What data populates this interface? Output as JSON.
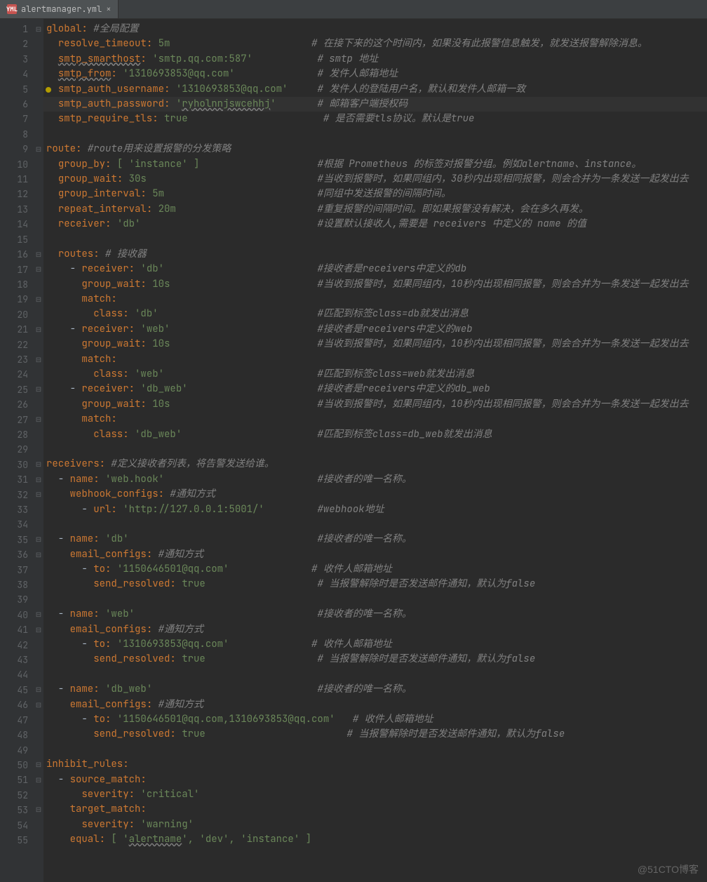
{
  "tab": {
    "filename": "alertmanager.yml",
    "icon": "YML"
  },
  "gutter": [
    "1",
    "2",
    "3",
    "4",
    "5",
    "6",
    "7",
    "8",
    "9",
    "10",
    "11",
    "12",
    "13",
    "14",
    "15",
    "16",
    "17",
    "18",
    "19",
    "20",
    "21",
    "22",
    "23",
    "24",
    "25",
    "26",
    "27",
    "28",
    "29",
    "30",
    "31",
    "32",
    "33",
    "34",
    "35",
    "36",
    "37",
    "38",
    "39",
    "40",
    "41",
    "42",
    "43",
    "44",
    "45",
    "46",
    "47",
    "48",
    "49",
    "50",
    "51",
    "52",
    "53",
    "54",
    "55"
  ],
  "code": {
    "l1": {
      "k": "global",
      "colon": ": ",
      "c": "#全局配置"
    },
    "l2": {
      "pad": "  ",
      "k": "resolve_timeout",
      "colon": ": ",
      "v": "5m",
      "cpad": "                        ",
      "c": "# 在接下来的这个时间内，如果没有此报警信息触发，就发送报警解除消息。"
    },
    "l3": {
      "pad": "  ",
      "k": "smtp_smarthost",
      "colon": ": ",
      "v": "'smtp.qq.com:587'",
      "cpad": "           ",
      "c": "# smtp 地址"
    },
    "l4": {
      "pad": "  ",
      "k": "smtp_from",
      "colon": ": ",
      "v": "'1310693853@qq.com'",
      "cpad": "              ",
      "c": "# 发件人邮箱地址"
    },
    "l5": {
      "pad": "  ",
      "k": "smtp_auth_username",
      "colon": ": ",
      "v": "'1310693853@qq.com'",
      "cpad": "     ",
      "c": "# 发件人的登陆用户名，默认和发件人邮箱一致"
    },
    "l6": {
      "pad": "  ",
      "k": "smtp_auth_password",
      "colon": ": ",
      "v": "'ryholnnjswcehhj'",
      "cpad": "       ",
      "c": "# 邮箱客户端授权码"
    },
    "l7": {
      "pad": "  ",
      "k": "smtp_require_tls",
      "colon": ": ",
      "v": "true",
      "cpad": "                       ",
      "c": "# 是否需要tls协议。默认是true"
    },
    "l9": {
      "k": "route",
      "colon": ": ",
      "c": "#route用来设置报警的分发策略"
    },
    "l10": {
      "pad": "  ",
      "k": "group_by",
      "colon": ": ",
      "v": "[ 'instance' ]",
      "cpad": "                    ",
      "c": "#根据 Prometheus 的标签对报警分组。例如alertname、instance。"
    },
    "l11": {
      "pad": "  ",
      "k": "group_wait",
      "colon": ": ",
      "v": "30s",
      "cpad": "                             ",
      "c": "#当收到报警时，如果同组内，30秒内出现相同报警，则会合并为一条发送一起发出去"
    },
    "l12": {
      "pad": "  ",
      "k": "group_interval",
      "colon": ": ",
      "v": "5m",
      "cpad": "                          ",
      "c": "#同组中发送报警的间隔时间。"
    },
    "l13": {
      "pad": "  ",
      "k": "repeat_interval",
      "colon": ": ",
      "v": "20m",
      "cpad": "                        ",
      "c": "#重复报警的间隔时间。即如果报警没有解决，会在多久再发。"
    },
    "l14": {
      "pad": "  ",
      "k": "receiver",
      "colon": ": ",
      "v": "'db'",
      "cpad": "                              ",
      "c": "#设置默认接收人,需要是 receivers 中定义的 name 的值"
    },
    "l16": {
      "pad": "  ",
      "k": "routes",
      "colon": ": ",
      "c": "# 接收器"
    },
    "l17": {
      "pad": "    - ",
      "k": "receiver",
      "colon": ": ",
      "v": "'db'",
      "cpad": "                          ",
      "c": "#接收者是receivers中定义的db"
    },
    "l18": {
      "pad": "      ",
      "k": "group_wait",
      "colon": ": ",
      "v": "10s",
      "cpad": "                         ",
      "c": "#当收到报警时，如果同组内，10秒内出现相同报警，则会合并为一条发送一起发出去"
    },
    "l19": {
      "pad": "      ",
      "k": "match",
      "colon": ":"
    },
    "l20": {
      "pad": "        ",
      "k": "class",
      "colon": ": ",
      "v": "'db'",
      "cpad": "                           ",
      "c": "#匹配到标签class=db就发出消息"
    },
    "l21": {
      "pad": "    - ",
      "k": "receiver",
      "colon": ": ",
      "v": "'web'",
      "cpad": "                         ",
      "c": "#接收者是receivers中定义的web"
    },
    "l22": {
      "pad": "      ",
      "k": "group_wait",
      "colon": ": ",
      "v": "10s",
      "cpad": "                         ",
      "c": "#当收到报警时，如果同组内，10秒内出现相同报警，则会合并为一条发送一起发出去"
    },
    "l23": {
      "pad": "      ",
      "k": "match",
      "colon": ":"
    },
    "l24": {
      "pad": "        ",
      "k": "class",
      "colon": ": ",
      "v": "'web'",
      "cpad": "                          ",
      "c": "#匹配到标签class=web就发出消息"
    },
    "l25": {
      "pad": "    - ",
      "k": "receiver",
      "colon": ": ",
      "v": "'db_web'",
      "cpad": "                      ",
      "c": "#接收者是receivers中定义的db_web"
    },
    "l26": {
      "pad": "      ",
      "k": "group_wait",
      "colon": ": ",
      "v": "10s",
      "cpad": "                         ",
      "c": "#当收到报警时，如果同组内，10秒内出现相同报警，则会合并为一条发送一起发出去"
    },
    "l27": {
      "pad": "      ",
      "k": "match",
      "colon": ":"
    },
    "l28": {
      "pad": "        ",
      "k": "class",
      "colon": ": ",
      "v": "'db_web'",
      "cpad": "                       ",
      "c": "#匹配到标签class=db_web就发出消息"
    },
    "l30": {
      "k": "receivers",
      "colon": ": ",
      "c": "#定义接收者列表，将告警发送给谁。"
    },
    "l31": {
      "pad": "  - ",
      "k": "name",
      "colon": ": ",
      "v": "'web.hook'",
      "cpad": "                          ",
      "c": "#接收者的唯一名称。"
    },
    "l32": {
      "pad": "    ",
      "k": "webhook_configs",
      "colon": ": ",
      "c": "#通知方式"
    },
    "l33": {
      "pad": "      - ",
      "k": "url",
      "colon": ": ",
      "v": "'http://127.0.0.1:5001/'",
      "cpad": "         ",
      "c": "#webhook地址"
    },
    "l35": {
      "pad": "  - ",
      "k": "name",
      "colon": ": ",
      "v": "'db'",
      "cpad": "                                ",
      "c": "#接收者的唯一名称。"
    },
    "l36": {
      "pad": "    ",
      "k": "email_configs",
      "colon": ": ",
      "c": "#通知方式"
    },
    "l37": {
      "pad": "      - ",
      "k": "to",
      "colon": ": ",
      "v": "'1150646501@qq.com'",
      "cpad": "              ",
      "c": "# 收件人邮箱地址"
    },
    "l38": {
      "pad": "        ",
      "k": "send_resolved",
      "colon": ": ",
      "v": "true",
      "cpad": "                   ",
      "c": "# 当报警解除时是否发送邮件通知，默认为false"
    },
    "l40": {
      "pad": "  - ",
      "k": "name",
      "colon": ": ",
      "v": "'web'",
      "cpad": "                               ",
      "c": "#接收者的唯一名称。"
    },
    "l41": {
      "pad": "    ",
      "k": "email_configs",
      "colon": ": ",
      "c": "#通知方式"
    },
    "l42": {
      "pad": "      - ",
      "k": "to",
      "colon": ": ",
      "v": "'1310693853@qq.com'",
      "cpad": "              ",
      "c": "# 收件人邮箱地址"
    },
    "l43": {
      "pad": "        ",
      "k": "send_resolved",
      "colon": ": ",
      "v": "true",
      "cpad": "                   ",
      "c": "# 当报警解除时是否发送邮件通知，默认为false"
    },
    "l45": {
      "pad": "  - ",
      "k": "name",
      "colon": ": ",
      "v": "'db_web'",
      "cpad": "                            ",
      "c": "#接收者的唯一名称。"
    },
    "l46": {
      "pad": "    ",
      "k": "email_configs",
      "colon": ": ",
      "c": "#通知方式"
    },
    "l47": {
      "pad": "      - ",
      "k": "to",
      "colon": ": ",
      "v": "'1150646501@qq.com,1310693853@qq.com'",
      "cpad": "   ",
      "c": "# 收件人邮箱地址"
    },
    "l48": {
      "pad": "        ",
      "k": "send_resolved",
      "colon": ": ",
      "v": "true",
      "cpad": "                        ",
      "c": "# 当报警解除时是否发送邮件通知，默认为false"
    },
    "l50": {
      "k": "inhibit_rules",
      "colon": ":"
    },
    "l51": {
      "pad": "  - ",
      "k": "source_match",
      "colon": ":"
    },
    "l52": {
      "pad": "      ",
      "k": "severity",
      "colon": ": ",
      "v": "'critical'"
    },
    "l53": {
      "pad": "    ",
      "k": "target_match",
      "colon": ":"
    },
    "l54": {
      "pad": "      ",
      "k": "severity",
      "colon": ": ",
      "v": "'warning'"
    },
    "l55": {
      "pad": "    ",
      "k": "equal",
      "colon": ": ",
      "v": "[ 'alertname', 'dev', 'instance' ]"
    }
  },
  "watermark": "@51CTO博客"
}
